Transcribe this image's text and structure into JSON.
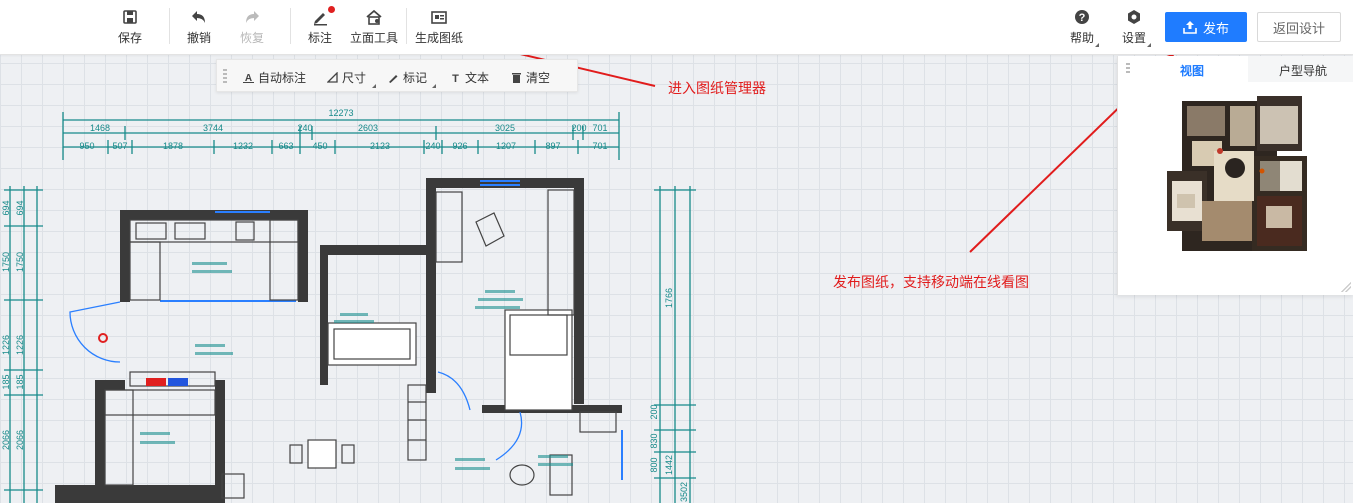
{
  "toolbar": {
    "save": "保存",
    "undo": "撤销",
    "redo": "恢复",
    "annotate": "标注",
    "elevation_tool": "立面工具",
    "generate_drawing": "生成图纸",
    "help": "帮助",
    "settings": "设置",
    "publish": "发布",
    "return_design": "返回设计"
  },
  "annotation_subbar": {
    "auto_annotate": "自动标注",
    "dimension": "尺寸",
    "mark": "标记",
    "text": "文本",
    "clear": "清空"
  },
  "view_panel": {
    "tab_view": "视图",
    "tab_floorplan_nav": "户型导航"
  },
  "callouts": {
    "drawing_manager": "进入图纸管理器",
    "publish_note": "发布图纸，支持移动端在线看图"
  },
  "dimensions": {
    "overall": "12273",
    "row1": [
      "1468",
      "3744",
      "240",
      "2603",
      "3025",
      "200",
      "701"
    ],
    "row2": [
      "950",
      "507",
      "1878",
      "1232",
      "663",
      "450",
      "2123",
      "240",
      "926",
      "1207",
      "897",
      "701"
    ],
    "left_col": [
      "694",
      "1750",
      "1226",
      "185",
      "2066"
    ],
    "left_col_b": [
      "694",
      "1750",
      "1226",
      "185",
      "2066"
    ],
    "right_col": [
      "1766"
    ],
    "right_bottom": [
      "200",
      "830",
      "800",
      "1442",
      "3502"
    ]
  },
  "colors": {
    "accent": "#1f7cff",
    "annotation": "#e11c1c",
    "dimension_line": "#178a8a",
    "wall": "#3a3a3a",
    "grid": "#dde1e6"
  }
}
